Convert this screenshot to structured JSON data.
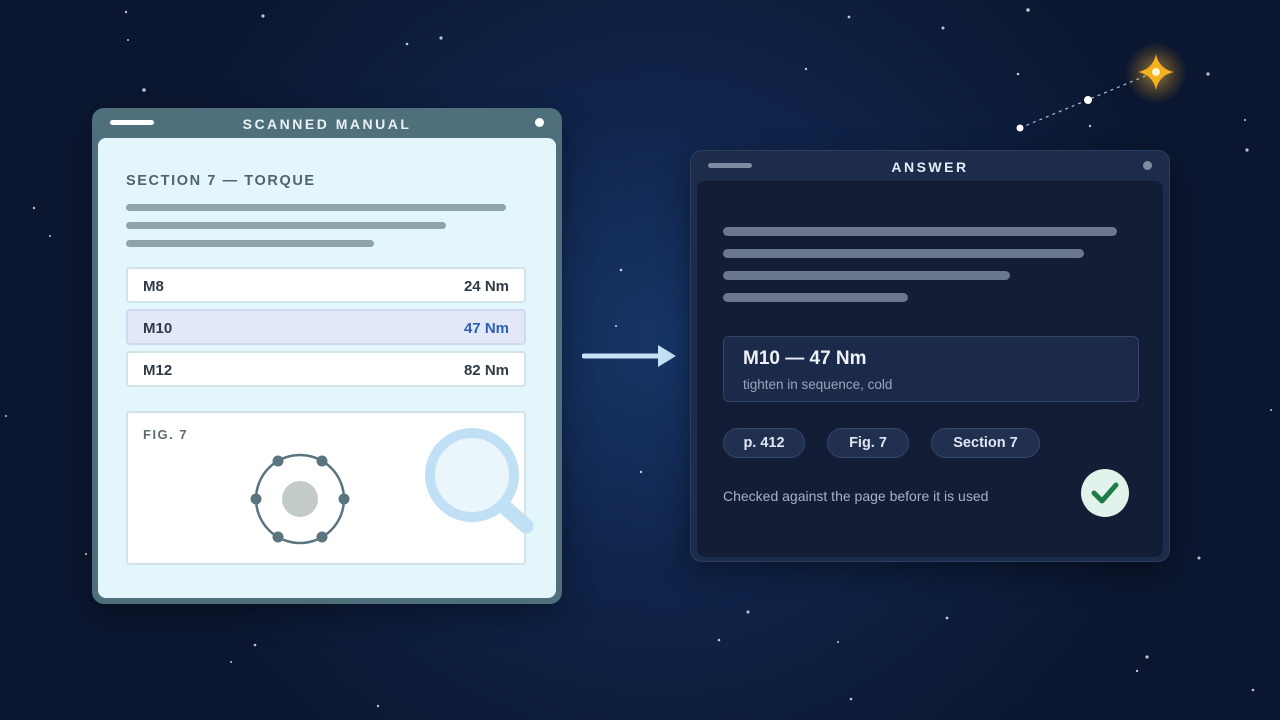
{
  "manual": {
    "title": "SCANNED MANUAL",
    "section_heading": "SECTION 7 — TORQUE",
    "rows": [
      {
        "size": "M8",
        "torque": "24 Nm"
      },
      {
        "size": "M10",
        "torque": "47 Nm"
      },
      {
        "size": "M12",
        "torque": "82 Nm"
      }
    ],
    "highlighted_row": "M10",
    "figure_label": "FIG. 7"
  },
  "answer": {
    "title": "ANSWER",
    "result_main": "M10 — 47 Nm",
    "result_sub": "tighten in sequence, cold",
    "citations": [
      "p. 412",
      "Fig. 7",
      "Section 7"
    ],
    "verification_note": "Checked against the page before it is used"
  },
  "icons": {
    "magnifier": "magnifier-icon",
    "arrow": "arrow-right-icon",
    "check": "check-icon",
    "sparkle": "sparkle-icon"
  },
  "colors": {
    "highlight_value": "#2d5fb5",
    "check_green": "#1f7a4a",
    "sparkle": "#f6b11e"
  }
}
